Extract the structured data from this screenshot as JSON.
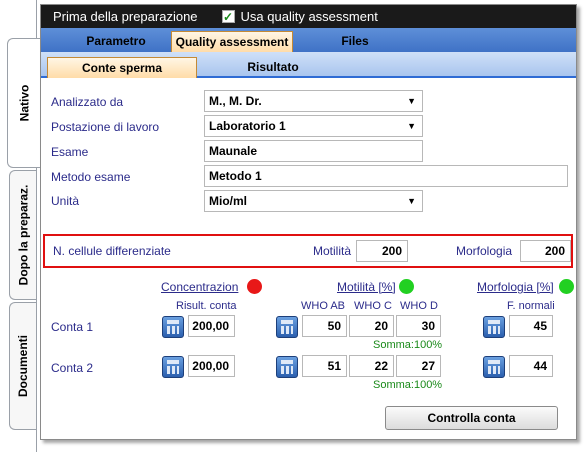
{
  "side_tabs": {
    "nativo": "Nativo",
    "dopo": "Dopo la preparaz.",
    "documenti": "Documenti"
  },
  "topbar": {
    "title": "Prima della preparazione",
    "qa_checked": true,
    "qa_label": "Usa quality assessment"
  },
  "tabs1": {
    "parametro": "Parametro",
    "quality": "Quality assessment",
    "files": "Files"
  },
  "tabs2": {
    "conte": "Conte sperma",
    "risultato": "Risultato"
  },
  "form": {
    "analizzato_label": "Analizzato da",
    "analizzato_value": "M., M. Dr.",
    "postazione_label": "Postazione di lavoro",
    "postazione_value": "Laboratorio 1",
    "esame_label": "Esame",
    "esame_value": "Maunale",
    "metodo_label": "Metodo esame",
    "metodo_value": "Metodo 1",
    "unita_label": "Unità",
    "unita_value": "Mio/ml"
  },
  "differentiated": {
    "label": "N. cellule differenziate",
    "motilita_label": "Motilità",
    "motilita_value": "200",
    "morfologia_label": "Morfologia",
    "morfologia_value": "200"
  },
  "groups": {
    "concentrazione": "Concentrazion",
    "motilita": "Motilità [%]",
    "morfologia": "Morfologia [%]",
    "status_colors": {
      "concentrazione": "#e81818",
      "motilita": "#22d022",
      "morfologia": "#22d022"
    }
  },
  "columns": {
    "risult": "Risult. conta",
    "who_ab": "WHO AB",
    "who_c": "WHO C",
    "who_d": "WHO D",
    "f_normali": "F. normali"
  },
  "rows": [
    {
      "label": "Conta 1",
      "conc": "200,00",
      "who_ab": "50",
      "who_c": "20",
      "who_d": "30",
      "somma": "Somma:100%",
      "f_normali": "45"
    },
    {
      "label": "Conta 2",
      "conc": "200,00",
      "who_ab": "51",
      "who_c": "22",
      "who_d": "27",
      "somma": "Somma:100%",
      "f_normali": "44"
    }
  ],
  "button": {
    "controlla": "Controlla conta"
  }
}
